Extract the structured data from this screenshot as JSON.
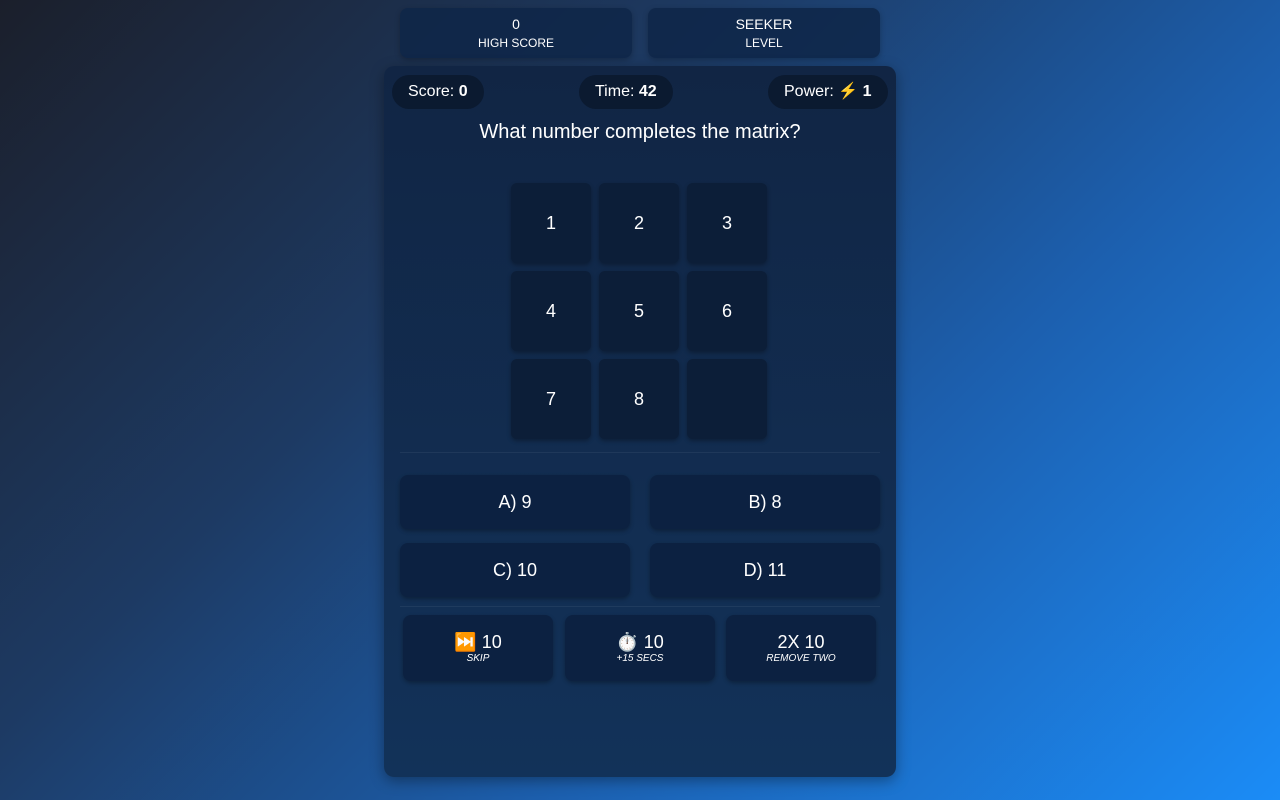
{
  "high_score": {
    "value": "0",
    "label": "HIGH SCORE"
  },
  "level": {
    "value": "SEEKER",
    "label": "LEVEL"
  },
  "hud": {
    "score_label": "Score:",
    "score_value": "0",
    "time_label": "Time:",
    "time_value": "42",
    "power_label": "Power:",
    "power_icon": "⚡",
    "power_value": "1"
  },
  "question": "What number completes the matrix?",
  "matrix": [
    "1",
    "2",
    "3",
    "4",
    "5",
    "6",
    "7",
    "8",
    ""
  ],
  "answers": [
    "A) 9",
    "B) 8",
    "C) 10",
    "D) 11"
  ],
  "powerups": [
    {
      "icon": "⏭️",
      "name": "skip-icon",
      "cost": "10",
      "label": "SKIP"
    },
    {
      "icon": "⏱️",
      "name": "stopwatch-icon",
      "cost": "10",
      "label": "+15 SECS"
    },
    {
      "icon": "2X",
      "name": "double-icon",
      "cost": "10",
      "label": "REMOVE TWO"
    }
  ]
}
